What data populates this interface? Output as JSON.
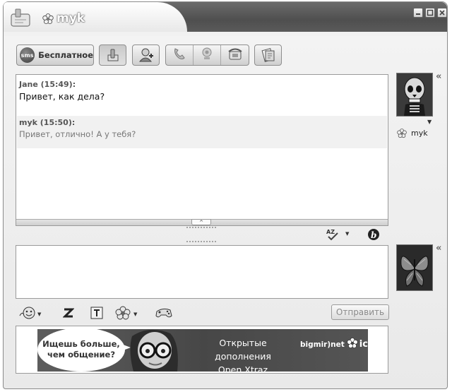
{
  "window": {
    "title": "myk"
  },
  "toolbar": {
    "sms_badge": "sms",
    "sms_label": "Бесплатное"
  },
  "history": {
    "messages": [
      {
        "header": "Jane (15:49):",
        "text": "Привет, как дела?"
      },
      {
        "header": "myk (15:50):",
        "text": "Привет, отлично! А у тебя?"
      }
    ],
    "collapse_glyph": "^"
  },
  "contact": {
    "name": "myk",
    "collapse_glyph": "«"
  },
  "input": {
    "value": ""
  },
  "composer": {
    "send_label": "Отправить"
  },
  "ad": {
    "bubble_line1": "Ищешь больше,",
    "bubble_line2": "чем общение?",
    "title_line1": "Открытые дополнения",
    "title_line2": "Open Xtraz",
    "brand": "bigmir)net",
    "brand_icq": "icq"
  },
  "icons": [
    "app-logo-icon",
    "status-flower-icon",
    "minimize-icon",
    "maximize-icon",
    "close-icon",
    "contact-info-icon",
    "add-contact-icon",
    "call-icon",
    "video-call-icon",
    "phone-icon",
    "send-file-icon",
    "spellcheck-icon",
    "bold-b-icon",
    "smiley-icon",
    "font-icon",
    "text-format-icon",
    "xtraz-icon",
    "games-icon"
  ]
}
